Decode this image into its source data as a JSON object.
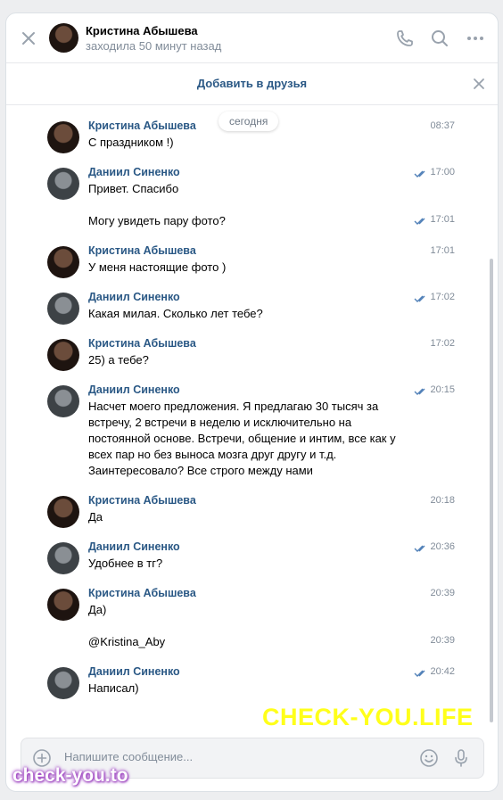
{
  "header": {
    "name": "Кристина Абышева",
    "status": "заходила 50 минут назад"
  },
  "add_friend": {
    "label": "Добавить в друзья"
  },
  "date_separator": "сегодня",
  "messages": [
    {
      "sender": "Кристина Абышева",
      "text": "С праздником !)",
      "time": "08:37"
    },
    {
      "sender": "Даниил Синенко",
      "text": "Привет. Спасибо",
      "time": "17:00"
    },
    {
      "sender": "",
      "text": "Могу увидеть пару фото?",
      "time": "17:01"
    },
    {
      "sender": "Кристина Абышева",
      "text": "У меня настоящие фото )",
      "time": "17:01"
    },
    {
      "sender": "Даниил Синенко",
      "text": "Какая милая. Сколько лет тебе?",
      "time": "17:02"
    },
    {
      "sender": "Кристина Абышева",
      "text": "25) а тебе?",
      "time": "17:02"
    },
    {
      "sender": "Даниил Синенко",
      "text": "Насчет моего предложения. Я предлагаю 30 тысяч за встречу, 2 встречи в неделю и исключительно на постоянной основе. Встречи, общение и интим, все как у всех пар но без выноса мозга друг другу и т.д. Заинтересовало? Все строго между нами",
      "time": "20:15"
    },
    {
      "sender": "Кристина Абышева",
      "text": "Да",
      "time": "20:18"
    },
    {
      "sender": "Даниил Синенко",
      "text": "Удобнее в тг?",
      "time": "20:36"
    },
    {
      "sender": "Кристина Абышева",
      "text": "Да)",
      "time": "20:39"
    },
    {
      "sender": "",
      "text": "@Kristina_Aby",
      "time": "20:39"
    },
    {
      "sender": "Даниил Синенко",
      "text": "Написал)",
      "time": "20:42"
    }
  ],
  "composer": {
    "placeholder": "Напишите сообщение..."
  },
  "watermarks": {
    "main": "CHECK-YOU.LIFE",
    "corner": "check-you.to"
  },
  "colors": {
    "accent": "#2a5885",
    "meta": "#818c99",
    "read_check": "#5181b8",
    "watermark": "#ffff1a"
  }
}
